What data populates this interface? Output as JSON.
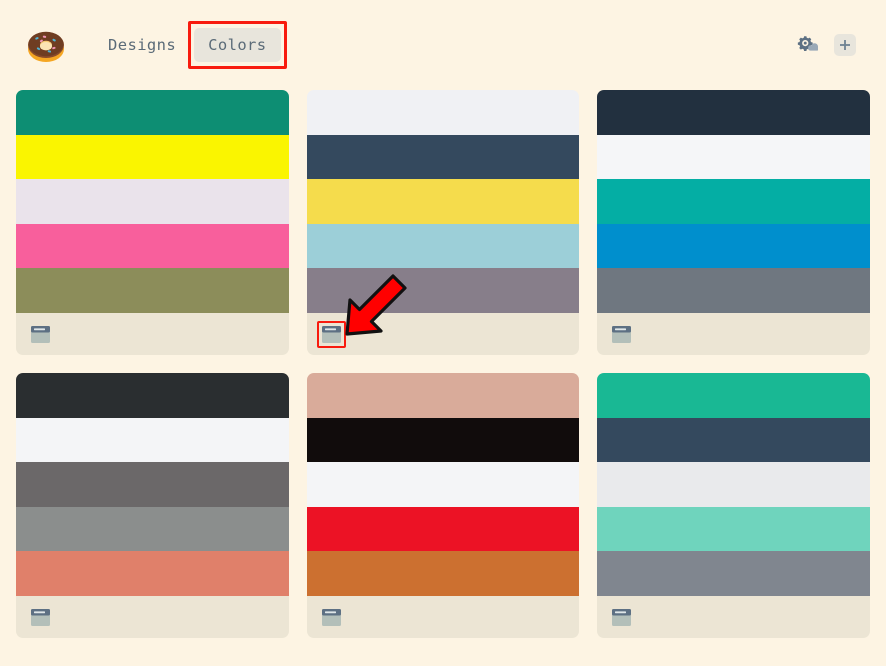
{
  "app": {
    "background_color": "#fdf4e3",
    "logo_icon": "donut-icon"
  },
  "header": {
    "nav": [
      {
        "label": "Designs",
        "active": false,
        "highlighted": false
      },
      {
        "label": "Colors",
        "active": true,
        "highlighted": true
      }
    ],
    "actions": [
      {
        "name": "settings-cloud-icon",
        "label": ""
      },
      {
        "name": "add-button",
        "label": "+"
      }
    ]
  },
  "palettes": [
    {
      "name": "palette-1",
      "footer_icon": "window-icon",
      "highlighted": false,
      "colors": [
        "#0d8e73",
        "#faf500",
        "#eae3eb",
        "#f85f9c",
        "#8c8d5a"
      ]
    },
    {
      "name": "palette-2",
      "footer_icon": "window-icon",
      "highlighted": true,
      "colors": [
        "#f0f1f4",
        "#34495e",
        "#f5dc4c",
        "#9ccfd8",
        "#877e8a"
      ]
    },
    {
      "name": "palette-3",
      "footer_icon": "window-icon",
      "highlighted": false,
      "colors": [
        "#22303f",
        "#f5f6f8",
        "#04aea4",
        "#008fcd",
        "#6f7780"
      ]
    },
    {
      "name": "palette-4",
      "footer_icon": "window-icon",
      "highlighted": false,
      "colors": [
        "#2a2e30",
        "#f4f5f7",
        "#6b6869",
        "#8b8e8d",
        "#e0806a"
      ]
    },
    {
      "name": "palette-5",
      "footer_icon": "window-icon",
      "highlighted": false,
      "colors": [
        "#d9ab9a",
        "#110c0c",
        "#f4f5f7",
        "#ec1225",
        "#cc7030"
      ]
    },
    {
      "name": "palette-6",
      "footer_icon": "window-icon",
      "highlighted": false,
      "colors": [
        "#19b894",
        "#34495e",
        "#e9eaec",
        "#6fd4bd",
        "#80868f"
      ]
    }
  ],
  "annotations": {
    "arrow": {
      "name": "red-arrow-pointer",
      "color": "#ff0000",
      "points_to": "palette-2 footer window icon"
    },
    "highlight_color": "#f81b0e"
  }
}
